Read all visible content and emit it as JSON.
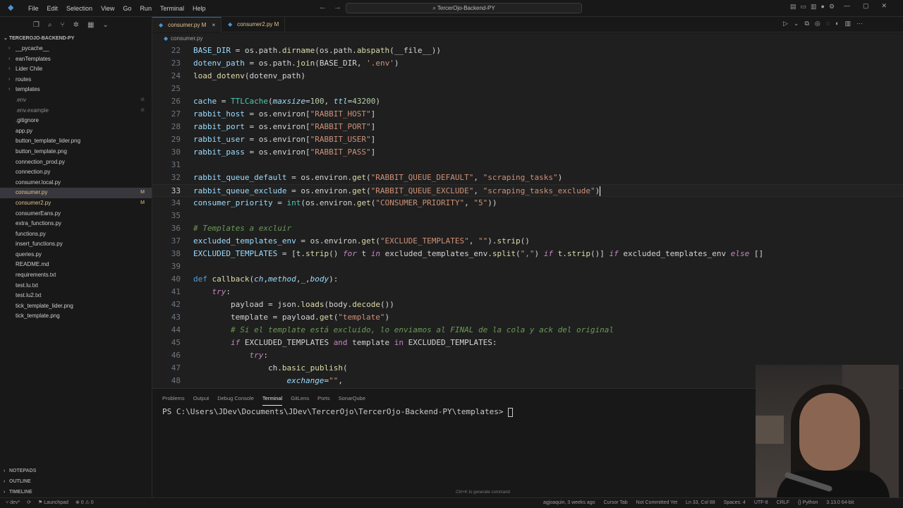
{
  "menu": [
    "File",
    "Edit",
    "Selection",
    "View",
    "Go",
    "Run",
    "Terminal",
    "Help"
  ],
  "search": {
    "text": "TercerOjo-Backend-PY"
  },
  "explorer": {
    "title": "TERCEROJO-BACKEND-PY",
    "items": [
      {
        "label": "__pycache__",
        "type": "folder",
        "badge": ""
      },
      {
        "label": "eanTemplates",
        "type": "folder",
        "badge": ""
      },
      {
        "label": "Lider Chile",
        "type": "folder",
        "badge": ""
      },
      {
        "label": "routes",
        "type": "folder",
        "badge": ""
      },
      {
        "label": "templates",
        "type": "folder",
        "badge": ""
      },
      {
        "label": ".env",
        "type": "file",
        "badge": "⊘"
      },
      {
        "label": ".env.example",
        "type": "file",
        "badge": "⊘"
      },
      {
        "label": ".gitignore",
        "type": "file",
        "badge": ""
      },
      {
        "label": "app.py",
        "type": "file",
        "badge": ""
      },
      {
        "label": "button_template_lider.png",
        "type": "file",
        "badge": ""
      },
      {
        "label": "button_template.png",
        "type": "file",
        "badge": ""
      },
      {
        "label": "connection_prod.py",
        "type": "file",
        "badge": ""
      },
      {
        "label": "connection.py",
        "type": "file",
        "badge": ""
      },
      {
        "label": "consumer.local.py",
        "type": "file",
        "badge": ""
      },
      {
        "label": "consumer.py",
        "type": "file",
        "badge": "M"
      },
      {
        "label": "consumer2.py",
        "type": "file",
        "badge": "M"
      },
      {
        "label": "consumerEans.py",
        "type": "file",
        "badge": ""
      },
      {
        "label": "extra_functions.py",
        "type": "file",
        "badge": ""
      },
      {
        "label": "functions.py",
        "type": "file",
        "badge": ""
      },
      {
        "label": "insert_functions.py",
        "type": "file",
        "badge": ""
      },
      {
        "label": "queries.py",
        "type": "file",
        "badge": ""
      },
      {
        "label": "README.md",
        "type": "file",
        "badge": ""
      },
      {
        "label": "requirements.txt",
        "type": "file",
        "badge": ""
      },
      {
        "label": "test.lu.txt",
        "type": "file",
        "badge": ""
      },
      {
        "label": "test.lu2.txt",
        "type": "file",
        "badge": ""
      },
      {
        "label": "tick_template_lider.png",
        "type": "file",
        "badge": ""
      },
      {
        "label": "tick_template.png",
        "type": "file",
        "badge": ""
      }
    ],
    "bottom_sections": [
      "NOTEPADS",
      "OUTLINE",
      "TIMELINE"
    ]
  },
  "tabs": [
    {
      "label": "consumer.py",
      "mod": "M"
    },
    {
      "label": "consumer2.py",
      "mod": "M"
    }
  ],
  "breadcrumb": "consumer.py",
  "panel": {
    "tabs": [
      "Problems",
      "Output",
      "Debug Console",
      "Terminal",
      "GitLens",
      "Ports",
      "SonarQube"
    ],
    "prompt": "PS C:\\Users\\JDev\\Documents\\JDev\\TercerOjo\\TercerOjo-Backend-PY\\templates> ",
    "hint": "Ctrl+K to generate command"
  },
  "status": {
    "left": [
      "dev*",
      "Launchpad",
      "⊗ 0 ⚠ 0"
    ],
    "right": [
      "agjoaquin, 3 weeks ago",
      "Cursor Tab",
      "Not Committed Yet",
      "Ln 33, Col 88",
      "Spaces: 4",
      "UTF-8",
      "CRLF",
      "{} Python",
      "3.13.0 64-bit"
    ]
  },
  "code": [
    {
      "n": "22",
      "t": [
        [
          "var",
          "BASE_DIR"
        ],
        [
          "p",
          " = os.path."
        ],
        [
          "fn",
          "dirname"
        ],
        [
          "p",
          "(os.path."
        ],
        [
          "fn",
          "abspath"
        ],
        [
          "p",
          "(__file__))"
        ]
      ]
    },
    {
      "n": "23",
      "t": [
        [
          "var",
          "dotenv_path"
        ],
        [
          "p",
          " = os.path."
        ],
        [
          "fn",
          "join"
        ],
        [
          "p",
          "(BASE_DIR, "
        ],
        [
          "str",
          "'.env'"
        ],
        [
          "p",
          ")"
        ]
      ]
    },
    {
      "n": "24",
      "t": [
        [
          "fn",
          "load_dotenv"
        ],
        [
          "p",
          "(dotenv_path)"
        ]
      ]
    },
    {
      "n": "25",
      "t": []
    },
    {
      "n": "26",
      "t": [
        [
          "var",
          "cache"
        ],
        [
          "p",
          " = "
        ],
        [
          "cls",
          "TTLCache"
        ],
        [
          "p",
          "("
        ],
        [
          "param",
          "maxsize"
        ],
        [
          "p",
          "="
        ],
        [
          "num",
          "100"
        ],
        [
          "p",
          ", "
        ],
        [
          "param",
          "ttl"
        ],
        [
          "p",
          "="
        ],
        [
          "num",
          "43200"
        ],
        [
          "p",
          ")"
        ]
      ]
    },
    {
      "n": "27",
      "t": [
        [
          "var",
          "rabbit_host"
        ],
        [
          "p",
          " = os.environ["
        ],
        [
          "str",
          "\"RABBIT_HOST\""
        ],
        [
          "p",
          "]"
        ]
      ]
    },
    {
      "n": "28",
      "t": [
        [
          "var",
          "rabbit_port"
        ],
        [
          "p",
          " = os.environ["
        ],
        [
          "str",
          "\"RABBIT_PORT\""
        ],
        [
          "p",
          "]"
        ]
      ]
    },
    {
      "n": "29",
      "t": [
        [
          "var",
          "rabbit_user"
        ],
        [
          "p",
          " = os.environ["
        ],
        [
          "str",
          "\"RABBIT_USER\""
        ],
        [
          "p",
          "]"
        ]
      ]
    },
    {
      "n": "30",
      "t": [
        [
          "var",
          "rabbit_pass"
        ],
        [
          "p",
          " = os.environ["
        ],
        [
          "str",
          "\"RABBIT_PASS\""
        ],
        [
          "p",
          "]"
        ]
      ]
    },
    {
      "n": "31",
      "t": []
    },
    {
      "n": "32",
      "t": [
        [
          "var",
          "rabbit_queue_default"
        ],
        [
          "p",
          " = os.environ."
        ],
        [
          "fn",
          "get"
        ],
        [
          "p",
          "("
        ],
        [
          "str",
          "\"RABBIT_QUEUE_DEFAULT\""
        ],
        [
          "p",
          ", "
        ],
        [
          "str",
          "\"scraping_tasks\""
        ],
        [
          "p",
          ")"
        ]
      ]
    },
    {
      "n": "33",
      "t": [
        [
          "var",
          "rabbit_queue_exclude"
        ],
        [
          "p",
          " = os.environ."
        ],
        [
          "fn",
          "get"
        ],
        [
          "p",
          "("
        ],
        [
          "str",
          "\"RABBIT_QUEUE_EXCLUDE\""
        ],
        [
          "p",
          ", "
        ],
        [
          "str",
          "\"scraping_tasks_exclude\""
        ],
        [
          "p",
          ")"
        ]
      ],
      "current": true
    },
    {
      "n": "34",
      "t": [
        [
          "var",
          "consumer_priority"
        ],
        [
          "p",
          " = "
        ],
        [
          "cls",
          "int"
        ],
        [
          "p",
          "(os.environ."
        ],
        [
          "fn",
          "get"
        ],
        [
          "p",
          "("
        ],
        [
          "str",
          "\"CONSUMER_PRIORITY\""
        ],
        [
          "p",
          ", "
        ],
        [
          "str",
          "\"5\""
        ],
        [
          "p",
          "))"
        ]
      ]
    },
    {
      "n": "35",
      "t": []
    },
    {
      "n": "36",
      "t": [
        [
          "cm",
          "# Templates a excluir"
        ]
      ]
    },
    {
      "n": "37",
      "t": [
        [
          "var",
          "excluded_templates_env"
        ],
        [
          "p",
          " = os.environ."
        ],
        [
          "fn",
          "get"
        ],
        [
          "p",
          "("
        ],
        [
          "str",
          "\"EXCLUDE_TEMPLATES\""
        ],
        [
          "p",
          ", "
        ],
        [
          "str",
          "\"\""
        ],
        [
          "p",
          ")."
        ],
        [
          "fn",
          "strip"
        ],
        [
          "p",
          "()"
        ]
      ]
    },
    {
      "n": "38",
      "t": [
        [
          "var",
          "EXCLUDED_TEMPLATES"
        ],
        [
          "p",
          " = [t."
        ],
        [
          "fn",
          "strip"
        ],
        [
          "p",
          "() "
        ],
        [
          "kwi",
          "for"
        ],
        [
          "p",
          " t "
        ],
        [
          "kwi",
          "in"
        ],
        [
          "p",
          " excluded_templates_env."
        ],
        [
          "fn",
          "split"
        ],
        [
          "p",
          "("
        ],
        [
          "str",
          "\",\""
        ],
        [
          "p",
          ") "
        ],
        [
          "kwi",
          "if"
        ],
        [
          "p",
          " t."
        ],
        [
          "fn",
          "strip"
        ],
        [
          "p",
          "()] "
        ],
        [
          "kwi",
          "if"
        ],
        [
          "p",
          " excluded_templates_env "
        ],
        [
          "kwi",
          "else"
        ],
        [
          "p",
          " []"
        ]
      ]
    },
    {
      "n": "39",
      "t": []
    },
    {
      "n": "40",
      "t": [
        [
          "def",
          "def"
        ],
        [
          "p",
          " "
        ],
        [
          "fn",
          "callback"
        ],
        [
          "p",
          "("
        ],
        [
          "param",
          "ch"
        ],
        [
          "p",
          ","
        ],
        [
          "param",
          "method"
        ],
        [
          "p",
          ","
        ],
        [
          "param",
          "_"
        ],
        [
          "p",
          ","
        ],
        [
          "param",
          "body"
        ],
        [
          "p",
          "):"
        ]
      ]
    },
    {
      "n": "41",
      "t": [
        [
          "p",
          "    "
        ],
        [
          "kwi",
          "try"
        ],
        [
          "p",
          ":"
        ]
      ]
    },
    {
      "n": "42",
      "t": [
        [
          "p",
          "        payload = json."
        ],
        [
          "fn",
          "loads"
        ],
        [
          "p",
          "(body."
        ],
        [
          "fn",
          "decode"
        ],
        [
          "p",
          "())"
        ]
      ]
    },
    {
      "n": "43",
      "t": [
        [
          "p",
          "        template = payload."
        ],
        [
          "fn",
          "get"
        ],
        [
          "p",
          "("
        ],
        [
          "str",
          "\"template\""
        ],
        [
          "p",
          ")"
        ]
      ]
    },
    {
      "n": "44",
      "t": [
        [
          "p",
          "        "
        ],
        [
          "cm",
          "# Si el template está excluido, lo enviamos al FINAL de la cola y ack del original"
        ]
      ]
    },
    {
      "n": "45",
      "t": [
        [
          "p",
          "        "
        ],
        [
          "kwi",
          "if"
        ],
        [
          "p",
          " EXCLUDED_TEMPLATES "
        ],
        [
          "kw",
          "and"
        ],
        [
          "p",
          " template "
        ],
        [
          "kw",
          "in"
        ],
        [
          "p",
          " EXCLUDED_TEMPLATES:"
        ]
      ]
    },
    {
      "n": "46",
      "t": [
        [
          "p",
          "            "
        ],
        [
          "kwi",
          "try"
        ],
        [
          "p",
          ":"
        ]
      ]
    },
    {
      "n": "47",
      "t": [
        [
          "p",
          "                ch."
        ],
        [
          "fn",
          "basic_publish"
        ],
        [
          "p",
          "("
        ]
      ]
    },
    {
      "n": "48",
      "t": [
        [
          "p",
          "                    "
        ],
        [
          "param",
          "exchange"
        ],
        [
          "p",
          "="
        ],
        [
          "str",
          "\"\""
        ],
        [
          "p",
          ","
        ]
      ]
    }
  ]
}
